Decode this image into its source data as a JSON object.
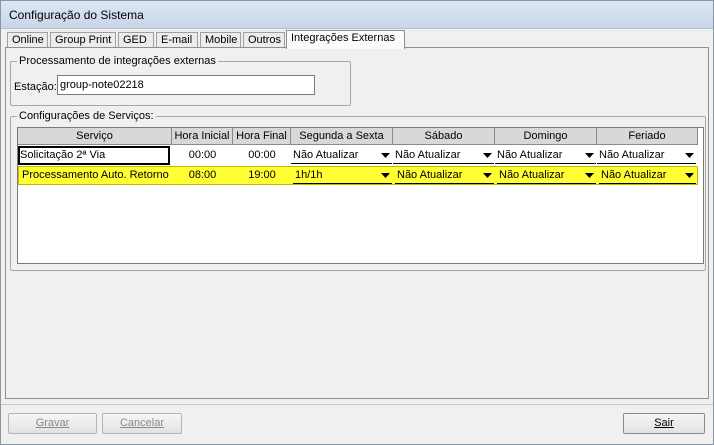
{
  "window": {
    "title": "Configuração do Sistema"
  },
  "tabs": [
    {
      "label": "Online"
    },
    {
      "label": "Group Print"
    },
    {
      "label": "GED"
    },
    {
      "label": "E-mail"
    },
    {
      "label": "Mobile"
    },
    {
      "label": "Outros"
    },
    {
      "label": "Integrações Externas",
      "active": true
    }
  ],
  "integration_group": {
    "legend": "Processamento de integrações externas",
    "station_label": "Estação:",
    "station_value": "group-note02218"
  },
  "services_group": {
    "legend": "Configurações de Serviços:",
    "columns": [
      "Serviço",
      "Hora Inicial",
      "Hora Final",
      "Segunda a Sexta",
      "Sábado",
      "Domingo",
      "Feriado"
    ],
    "rows": [
      {
        "service": "Solicitação 2ª Via",
        "start": "00:00",
        "end": "00:00",
        "weekdays": "Não Atualizar",
        "saturday": "Não Atualizar",
        "sunday": "Não Atualizar",
        "holiday": "Não Atualizar",
        "highlighted": false
      },
      {
        "service": "Processamento Auto. Retorno",
        "start": "08:00",
        "end": "19:00",
        "weekdays": "1h/1h",
        "saturday": "Não Atualizar",
        "sunday": "Não Atualizar",
        "holiday": "Não Atualizar",
        "highlighted": true
      }
    ]
  },
  "buttons": {
    "save": {
      "label": "Gravar",
      "enabled": false
    },
    "cancel": {
      "label": "Cancelar",
      "enabled": false
    },
    "exit": {
      "label": "Sair",
      "enabled": true
    }
  },
  "colors": {
    "highlight_row": "#ffff33"
  },
  "icons": {
    "dropdown": "dropdown-arrow-icon"
  }
}
